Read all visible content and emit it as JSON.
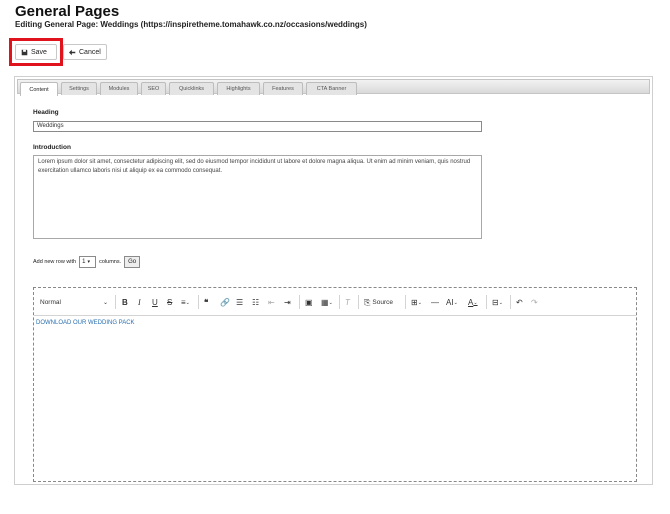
{
  "header": {
    "title": "General Pages",
    "subtitle": "Editing General Page: Weddings   (https://inspiretheme.tomahawk.co.nz/occasions/weddings)"
  },
  "actions": {
    "save_label": "Save",
    "cancel_label": "Cancel",
    "highlight_color": "#e0121b"
  },
  "tabs": [
    {
      "label": "Content",
      "active": true
    },
    {
      "label": "Settings"
    },
    {
      "label": "Modules"
    },
    {
      "label": "SEO"
    },
    {
      "label": "Quicklinks"
    },
    {
      "label": "Highlights"
    },
    {
      "label": "Features"
    },
    {
      "label": "CTA Banner"
    }
  ],
  "form": {
    "heading_label": "Heading",
    "heading_value": "Weddings",
    "intro_label": "Introduction",
    "intro_value": "Lorem ipsum dolor sit amet, consectetur adipiscing elit, sed do eiusmod tempor incididunt ut labore et dolore magna aliqua. Ut enim ad minim veniam, quis nostrud exercitation ullamco laboris nisi ut aliquip ex ea commodo consequat."
  },
  "row_add": {
    "prefix": "Add new row with",
    "columns_value": "1",
    "suffix": "columns.",
    "go_label": "Go"
  },
  "editor": {
    "paragraph_format": "Normal",
    "source_label": "Source",
    "content_link": "DOWNLOAD OUR WEDDING PACK",
    "link_color": "#2a6fb0"
  }
}
